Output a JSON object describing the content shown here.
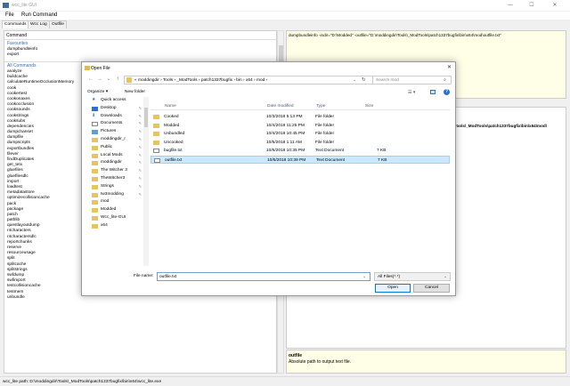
{
  "window": {
    "title": "wcc_lite GUI"
  },
  "menubar": [
    "File",
    "Run Command"
  ],
  "tabs": [
    "Commands",
    "Wcc Log",
    "Outfile"
  ],
  "leftpane": {
    "command_label": "Command",
    "favourites_header": "Favourites",
    "favourites": [
      "dumpbundleinfo",
      "export"
    ],
    "all_header": "All Commands",
    "commands": [
      "analyze",
      "buildcache",
      "calculateRuntimeOcclusionMemory",
      "cook",
      "cookertest",
      "cookonaxes",
      "cookocclusion",
      "cooksounds",
      "cookstrings",
      "cooksubs",
      "dependencies",
      "dumpchanset",
      "dumpfile",
      "dumpscripts",
      "exportbundles",
      "filever",
      "findDuplicates",
      "get_tetx",
      "gluefiles",
      "gluefilesdlc",
      "import",
      "loadtest",
      "metadatastore",
      "optimizecollisioncache",
      "pack",
      "package",
      "patch",
      "pathlib",
      "questlayoutdump",
      "r4characters",
      "r4charactersdlc",
      "reportchunks",
      "reserve",
      "resourceusage",
      "split",
      "splitcache",
      "splitstrings",
      "swfdump",
      "swfimport",
      "testcollisioncache",
      "testmem",
      "unbundle"
    ]
  },
  "cmdbox": {
    "text": "dumpbundleinfo -indir=\"D:\\Modded\" -outfile=\"D:\\moddingdir\\Tools\\_ModTools\\patch1337bugfix\\bin\\x64\\mod\\outfile.txt\""
  },
  "output": {
    "text": "Tools\\_ModTools\\patch1337bugfix\\bin\\x64\\mod\\"
  },
  "help": {
    "title": "outfile",
    "desc": "Absolute path to output text file."
  },
  "statusbar": {
    "text": "wcc_lite path: D:\\moddingdir\\Tools\\_ModTools\\patch1337bugfix\\bin\\x64\\wcc_lite.exe"
  },
  "dialog": {
    "title": "Open File",
    "address": "«  moddingdir  ›  Tools  ›  _ModTools  ›  patch1337bugfix  ›  bin  ›  x64  ›  mod  ›",
    "search_placeholder": "Search mod",
    "organize": "Organize ▾",
    "new_folder": "New folder",
    "nav": [
      {
        "label": "Quick access",
        "icon": "star-icon"
      },
      {
        "label": "Desktop",
        "icon": "desktop-icon",
        "pin": true
      },
      {
        "label": "Downloads",
        "icon": "download-icon",
        "pin": true
      },
      {
        "label": "Documents",
        "icon": "document-icon",
        "pin": true
      },
      {
        "label": "Pictures",
        "icon": "picture-icon",
        "pin": true
      },
      {
        "label": "moddingdir_r",
        "icon": "folder-icon",
        "pin": true
      },
      {
        "label": "Public",
        "icon": "folder-icon",
        "pin": true
      },
      {
        "label": "Local Mods",
        "icon": "folder-icon",
        "pin": true
      },
      {
        "label": "moddingdir",
        "icon": "folder-icon",
        "pin": true
      },
      {
        "label": "The Witcher 3",
        "icon": "folder-icon",
        "pin": true
      },
      {
        "label": "TheWitcher3",
        "icon": "folder-icon",
        "pin": true
      },
      {
        "label": "Strings",
        "icon": "folder-icon",
        "pin": true
      },
      {
        "label": "tw3modding",
        "icon": "folder-icon",
        "pin": true
      },
      {
        "label": "mod",
        "icon": "folder-icon"
      },
      {
        "label": "Modded",
        "icon": "folder-icon"
      },
      {
        "label": "Wcc_lite-GUI",
        "icon": "folder-icon"
      },
      {
        "label": "x64",
        "icon": "folder-icon"
      }
    ],
    "columns": [
      "Name",
      "Date modified",
      "Type",
      "Size"
    ],
    "files": [
      {
        "name": "Cooked",
        "date": "10/3/2018 5:13 PM",
        "type": "File folder",
        "size": "",
        "kind": "folder"
      },
      {
        "name": "Modded",
        "date": "10/4/2018 11:25 PM",
        "type": "File folder",
        "size": "",
        "kind": "folder"
      },
      {
        "name": "Unbundled",
        "date": "10/4/2018 10:45 PM",
        "type": "File folder",
        "size": "",
        "kind": "folder"
      },
      {
        "name": "Uncooked",
        "date": "10/5/2018 1:11 AM",
        "type": "File folder",
        "size": "",
        "kind": "folder"
      },
      {
        "name": "bugfile.txt",
        "date": "10/6/2018 10:35 PM",
        "type": "Text Document",
        "size": "7 KB",
        "kind": "doc"
      },
      {
        "name": "outfile.txt",
        "date": "10/6/2018 10:39 PM",
        "type": "Text Document",
        "size": "7 KB",
        "kind": "doc",
        "selected": true
      }
    ],
    "filename_label": "File name:",
    "filename_value": "outfile.txt",
    "filter_value": "All Files(*.*)",
    "open_label": "Open",
    "cancel_label": "Cancel"
  }
}
